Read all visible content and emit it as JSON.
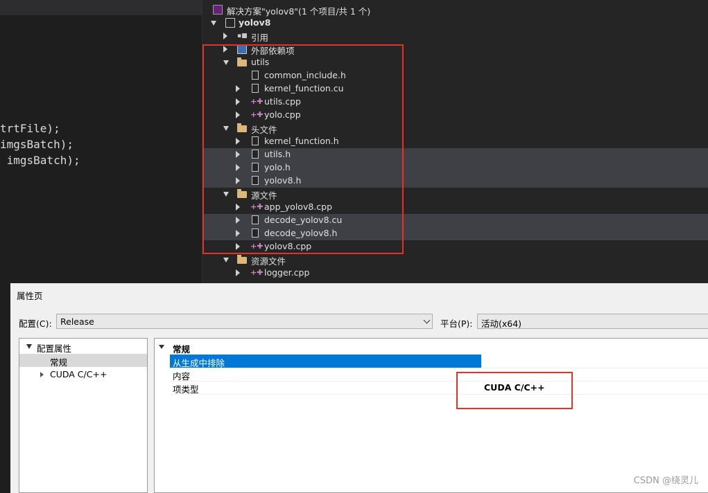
{
  "code": {
    "lines": [
      "trtFile);",
      "imgsBatch);",
      " imgsBatch);"
    ]
  },
  "solution": {
    "title": "解决方案\"yolov8\"(1 个项目/共 1 个)",
    "project": "yolov8",
    "items": [
      {
        "label": "引用"
      },
      {
        "label": "外部依赖项"
      },
      {
        "label": "utils"
      },
      {
        "label": "common_include.h"
      },
      {
        "label": "kernel_function.cu"
      },
      {
        "label": "utils.cpp"
      },
      {
        "label": "yolo.cpp"
      },
      {
        "label": "头文件"
      },
      {
        "label": "kernel_function.h"
      },
      {
        "label": "utils.h"
      },
      {
        "label": "yolo.h"
      },
      {
        "label": "yolov8.h"
      },
      {
        "label": "源文件"
      },
      {
        "label": "app_yolov8.cpp"
      },
      {
        "label": "decode_yolov8.cu"
      },
      {
        "label": "decode_yolov8.h"
      },
      {
        "label": "yolov8.cpp"
      },
      {
        "label": "资源文件"
      },
      {
        "label": "logger.cpp"
      }
    ]
  },
  "dialog": {
    "title": "属性页",
    "config_label": "配置(C):",
    "config_value": "Release",
    "platform_label": "平台(P):",
    "platform_value": "活动(x64)",
    "tree": {
      "root": "配置属性",
      "general": "常规",
      "cuda": "CUDA C/C++"
    },
    "section": "常规",
    "properties": [
      {
        "name": "从生成中排除",
        "value": ""
      },
      {
        "name": "内容",
        "value": ""
      },
      {
        "name": "项类型",
        "value": "CUDA C/C++"
      }
    ]
  },
  "watermark": "CSDN @绕灵儿",
  "colors": {
    "accent": "#0078d7",
    "highlight_box": "#e0332a"
  }
}
